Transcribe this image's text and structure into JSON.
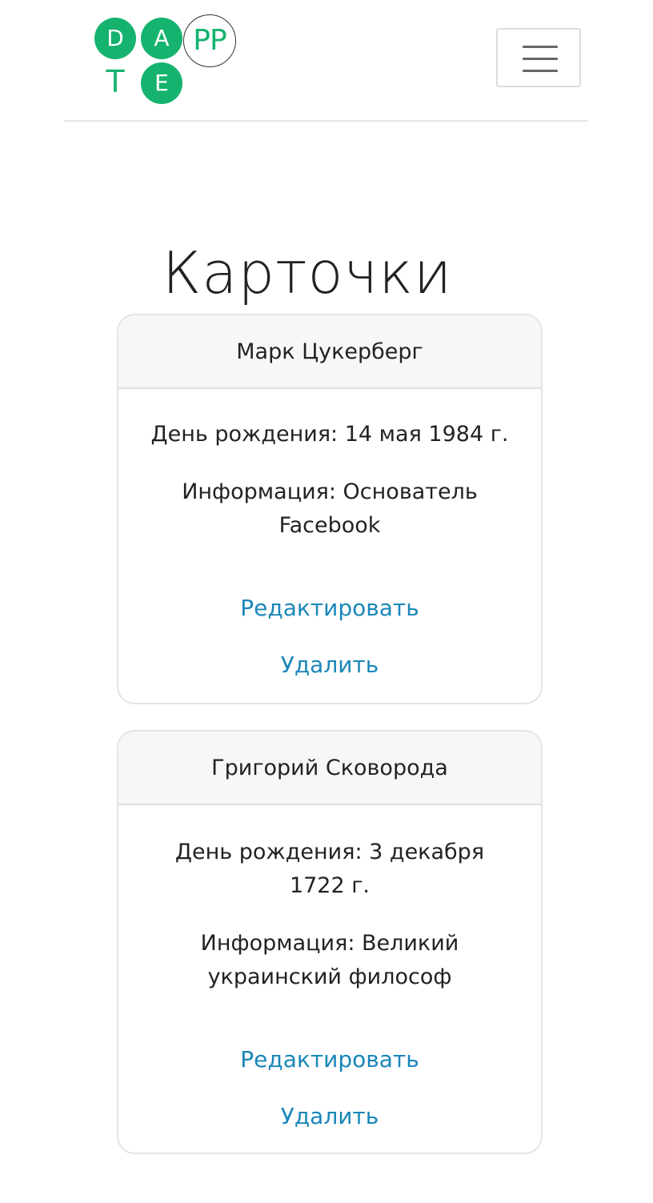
{
  "header": {
    "logo": {
      "letters": [
        "D",
        "A",
        "PP",
        "T",
        "E"
      ],
      "brand_color": "#15b36e"
    },
    "menu_icon": "hamburger-menu-icon"
  },
  "main": {
    "title": "Карточки",
    "cards": [
      {
        "name": "Марк Цукерберг",
        "birthday": "День рождения: 14 мая 1984 г.",
        "info": "Информация: Основатель Facebook",
        "edit_label": "Редактировать",
        "delete_label": "Удалить"
      },
      {
        "name": "Григорий Сковорода",
        "birthday": "День рождения: 3 декабря 1722 г.",
        "info": "Информация: Великий украинский философ",
        "edit_label": "Редактировать",
        "delete_label": "Удалить"
      }
    ]
  },
  "colors": {
    "link": "#1a87b8",
    "text": "#222222",
    "card_header_bg": "#f7f7f7"
  }
}
